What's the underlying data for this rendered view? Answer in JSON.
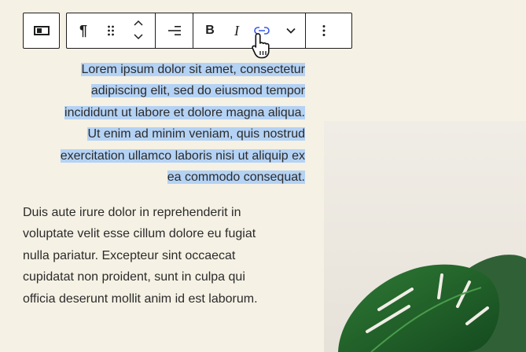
{
  "toolbar": {
    "block_type_icon": "block-type-icon",
    "paragraph_icon": "paragraph-icon",
    "drag_icon": "drag-handle-icon",
    "move_up_icon": "chevron-up-icon",
    "move_down_icon": "chevron-down-icon",
    "align_icon": "align-right-icon",
    "bold_label": "B",
    "italic_label": "I",
    "link_icon": "link-icon",
    "more_rich_text_icon": "chevron-down-icon",
    "options_icon": "more-vertical-icon"
  },
  "content": {
    "paragraph1_lines": [
      "Lorem ipsum dolor sit amet, consectetur",
      "adipiscing elit, sed do eiusmod tempor",
      "incididunt ut labore et dolore magna aliqua.",
      "Ut enim ad minim veniam, quis nostrud",
      "exercitation ullamco laboris nisi ut aliquip ex",
      "ea commodo consequat."
    ],
    "paragraph2_lines": [
      "Duis aute irure dolor in reprehenderit in",
      "voluptate velit esse cillum dolore eu fugiat",
      "nulla pariatur. Excepteur sint occaecat",
      "cupidatat non proident, sunt in culpa qui",
      "officia deserunt mollit anim id est laborum."
    ]
  },
  "image": {
    "subject": "monstera-plant-image"
  },
  "colors": {
    "background": "#f5f1e4",
    "selection": "#b4d2f4",
    "toolbar_border": "#1e1e1e",
    "link_icon": "#3858e9",
    "leaf": "#1f5a2a"
  }
}
